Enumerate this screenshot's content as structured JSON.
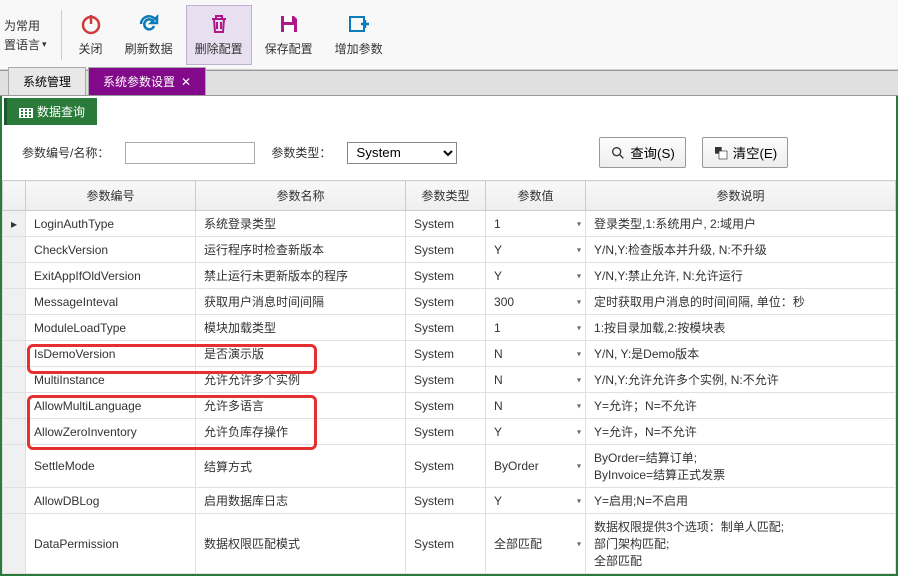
{
  "toolbar": {
    "leftLabel1": "为常用",
    "leftLabel2": "置语言",
    "close": "关闭",
    "refresh": "刷新数据",
    "delete": "删除配置",
    "save": "保存配置",
    "addparam": "增加参数"
  },
  "tabs": {
    "main": "系统管理",
    "active": "系统参数设置"
  },
  "subtab": "数据查询",
  "filter": {
    "nameLabel": "参数编号/名称：",
    "typeLabel": "参数类型：",
    "typeValue": "System",
    "searchBtn": "查询(S)",
    "clearBtn": "清空(E)"
  },
  "columns": {
    "c1": "参数编号",
    "c2": "参数名称",
    "c3": "参数类型",
    "c4": "参数值",
    "c5": "参数说明"
  },
  "rows": [
    {
      "mark": "▸",
      "id": "LoginAuthType",
      "name": "系统登录类型",
      "type": "System",
      "val": "1",
      "desc": "登录类型,1:系统用户, 2:域用户"
    },
    {
      "mark": "",
      "id": "CheckVersion",
      "name": "运行程序时检查新版本",
      "type": "System",
      "val": "Y",
      "desc": "Y/N,Y:检查版本并升级, N:不升级"
    },
    {
      "mark": "",
      "id": "ExitAppIfOldVersion",
      "name": "禁止运行未更新版本的程序",
      "type": "System",
      "val": "Y",
      "desc": "Y/N,Y:禁止允许, N:允许运行"
    },
    {
      "mark": "",
      "id": "MessageInteval",
      "name": "获取用户消息时间间隔",
      "type": "System",
      "val": "300",
      "desc": "定时获取用户消息的时间间隔, 单位：秒"
    },
    {
      "mark": "",
      "id": "ModuleLoadType",
      "name": "模块加载类型",
      "type": "System",
      "val": "1",
      "desc": "1:按目录加载,2:按模块表"
    },
    {
      "mark": "",
      "id": "IsDemoVersion",
      "name": "是否演示版",
      "type": "System",
      "val": "N",
      "desc": "Y/N, Y:是Demo版本"
    },
    {
      "mark": "",
      "id": "MultiInstance",
      "name": "允许允许多个实例",
      "type": "System",
      "val": "N",
      "desc": "Y/N,Y:允许允许多个实例, N:不允许"
    },
    {
      "mark": "",
      "id": "AllowMultiLanguage",
      "name": "允许多语言",
      "type": "System",
      "val": "N",
      "desc": "Y=允许；N=不允许"
    },
    {
      "mark": "",
      "id": "AllowZeroInventory",
      "name": "允许负库存操作",
      "type": "System",
      "val": "Y",
      "desc": "Y=允许，N=不允许"
    },
    {
      "mark": "",
      "id": "SettleMode",
      "name": "结算方式",
      "type": "System",
      "val": "ByOrder",
      "desc": "ByOrder=结算订单;\nByInvoice=结算正式发票"
    },
    {
      "mark": "",
      "id": "AllowDBLog",
      "name": "启用数据库日志",
      "type": "System",
      "val": "Y",
      "desc": "Y=启用;N=不启用"
    },
    {
      "mark": "",
      "id": "DataPermission",
      "name": "数据权限匹配模式",
      "type": "System",
      "val": "全部匹配",
      "desc": "数据权限提供3个选项：制单人匹配;\n部门架构匹配;\n全部匹配"
    }
  ]
}
